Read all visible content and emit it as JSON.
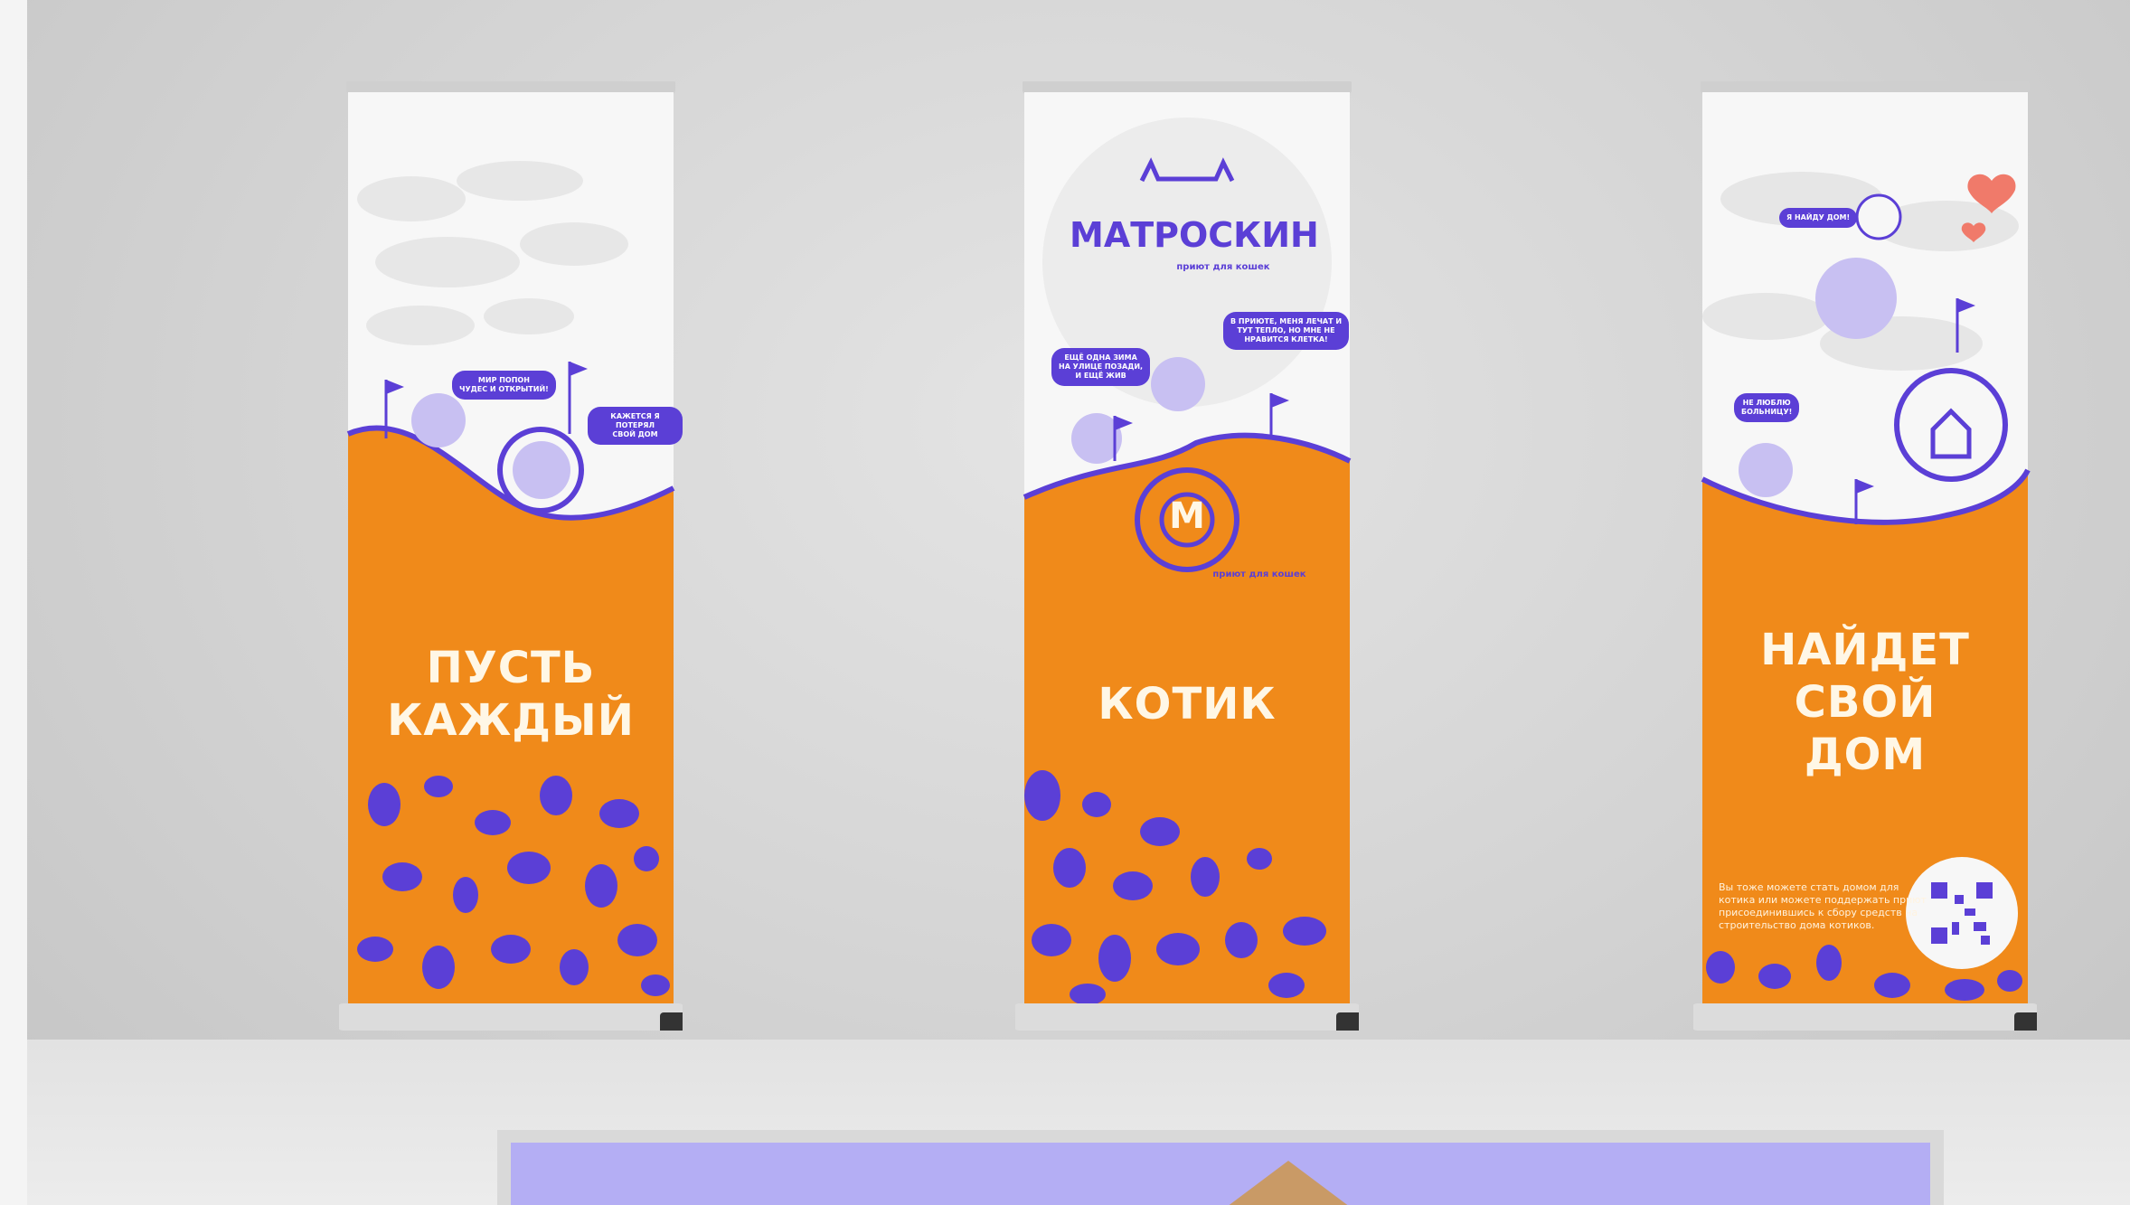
{
  "banners": [
    {
      "headline": "ПУСТЬ\nКАЖДЫЙ",
      "bubbles": [
        "МИР ПОПОН\nЧУДЕС И ОТКРЫТИЙ!",
        "КАЖЕТСЯ Я ПОТЕРЯЛ\nСВОЙ ДОМ"
      ]
    },
    {
      "brand": "МАТРОСКИН",
      "brand_sub": "приют для кошек",
      "headline": "КОТИК",
      "bubbles": [
        "ЕЩЁ ОДНА ЗИМА\nНА УЛИЦЕ ПОЗАДИ,\nИ ЕЩЁ ЖИВ",
        "В ПРИЮТЕ, МЕНЯ ЛЕЧАТ И\nТУТ ТЕПЛО, НО МНЕ НЕ\nНРАВИТСЯ КЛЕТКА!"
      ],
      "badge_letter": "M",
      "badge_text": "приют для кошек"
    },
    {
      "headline": "НАЙДЕТ\nСВОЙ\nДОМ",
      "bubbles": [
        "Я НАЙДУ ДОМ!",
        "НЕ ЛЮБЛЮ\nБОЛЬНИЦУ!"
      ],
      "note": "Вы тоже можете стать домом для\nкотика или можете поддержать приют\nприсоединившись к сбору средств на\nстроительство дома котиков."
    }
  ],
  "colors": {
    "orange": "#f08a1a",
    "purple": "#5b3fd6",
    "paper": "#f7f7f7"
  }
}
